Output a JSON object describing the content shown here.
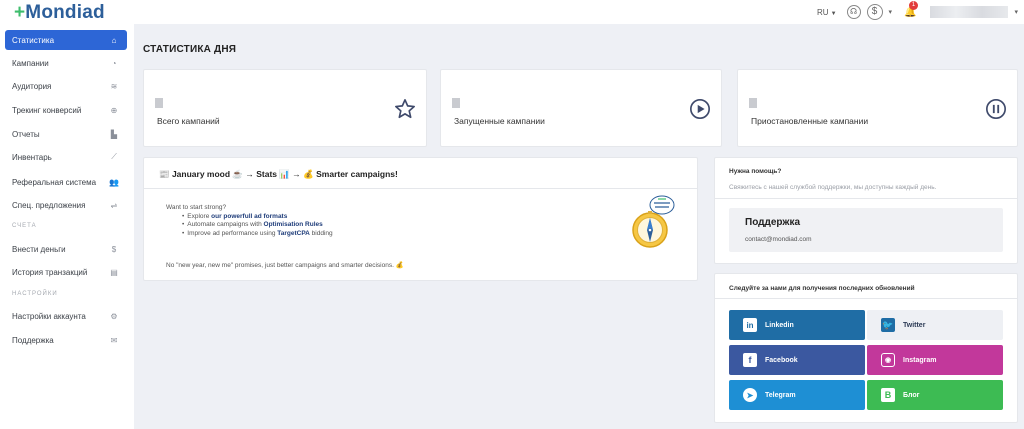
{
  "app": {
    "logo_text": "Mondiad",
    "logo_plus": "+"
  },
  "topbar": {
    "lang": "RU",
    "balance_icon": "$",
    "notifications_count": "1"
  },
  "sidebar": {
    "items": [
      {
        "label": "Статистика",
        "icon": "home-icon",
        "active": true
      },
      {
        "label": "Кампании",
        "icon": "pie-icon"
      },
      {
        "label": "Аудитория",
        "icon": "layers-icon"
      },
      {
        "label": "Трекинг конверсий",
        "icon": "globe-icon"
      },
      {
        "label": "Отчеты",
        "icon": "bar-chart-icon"
      },
      {
        "label": "Инвентарь",
        "icon": "line-chart-icon"
      },
      {
        "label": "Реферальная система",
        "icon": "users-icon"
      },
      {
        "label": "Спец. предложения",
        "icon": "handshake-icon"
      },
      {
        "label": "Внести деньги",
        "icon": "dollar-icon"
      },
      {
        "label": "История транзакций",
        "icon": "wallet-icon"
      },
      {
        "label": "Настройки аккаунта",
        "icon": "gears-icon"
      },
      {
        "label": "Поддержка",
        "icon": "mail-icon"
      }
    ],
    "sections": {
      "accounts": "СЧЕТА",
      "settings": "НАСТРОЙКИ"
    }
  },
  "main": {
    "title": "СТАТИСТИКА ДНЯ",
    "stats": [
      {
        "label": "Всего кампаний",
        "icon": "star-icon"
      },
      {
        "label": "Запущенные кампании",
        "icon": "play-icon"
      },
      {
        "label": "Приостановленные кампании",
        "icon": "pause-icon"
      }
    ],
    "promo": {
      "headline": "📰 January mood ☕ → Stats 📊 → 💰 Smarter campaigns!",
      "intro": "Want to start strong?",
      "bullets": [
        {
          "pre": "Explore ",
          "bold": "our powerfull ad formats",
          "post": ""
        },
        {
          "pre": "Automate campaigns with ",
          "bold": "Optimisation Rules",
          "post": ""
        },
        {
          "pre": "Improve ad performance using ",
          "bold": "TargetCPA",
          "post": " bidding"
        }
      ],
      "closing": "No \"new year, new me\" promises, just better campaigns and smarter decisions. 💰"
    },
    "help": {
      "title": "Нужна помощь?",
      "subtitle": "Свяжитесь с нашей службой поддержки, мы доступны каждый день.",
      "support_title": "Поддержка",
      "support_email": "contact@mondiad.com"
    },
    "social": {
      "title": "Следуйте за нами для получения последних обновлений",
      "buttons": [
        {
          "label": "Linkedin",
          "icon": "linkedin-icon",
          "color": "#1f6da5"
        },
        {
          "label": "Twitter",
          "icon": "twitter-icon",
          "color": "#eef0f4"
        },
        {
          "label": "Facebook",
          "icon": "facebook-icon",
          "color": "#3b58a0"
        },
        {
          "label": "Instagram",
          "icon": "instagram-icon",
          "color": "#c2389b"
        },
        {
          "label": "Telegram",
          "icon": "telegram-icon",
          "color": "#1e8fd4"
        },
        {
          "label": "Блог",
          "icon": "blogger-icon",
          "color": "#3dbb53"
        }
      ]
    }
  },
  "colors": {
    "accent": "#2d66d6",
    "brand": "#2d5f9a",
    "brand_plus": "#3ebd6c"
  }
}
